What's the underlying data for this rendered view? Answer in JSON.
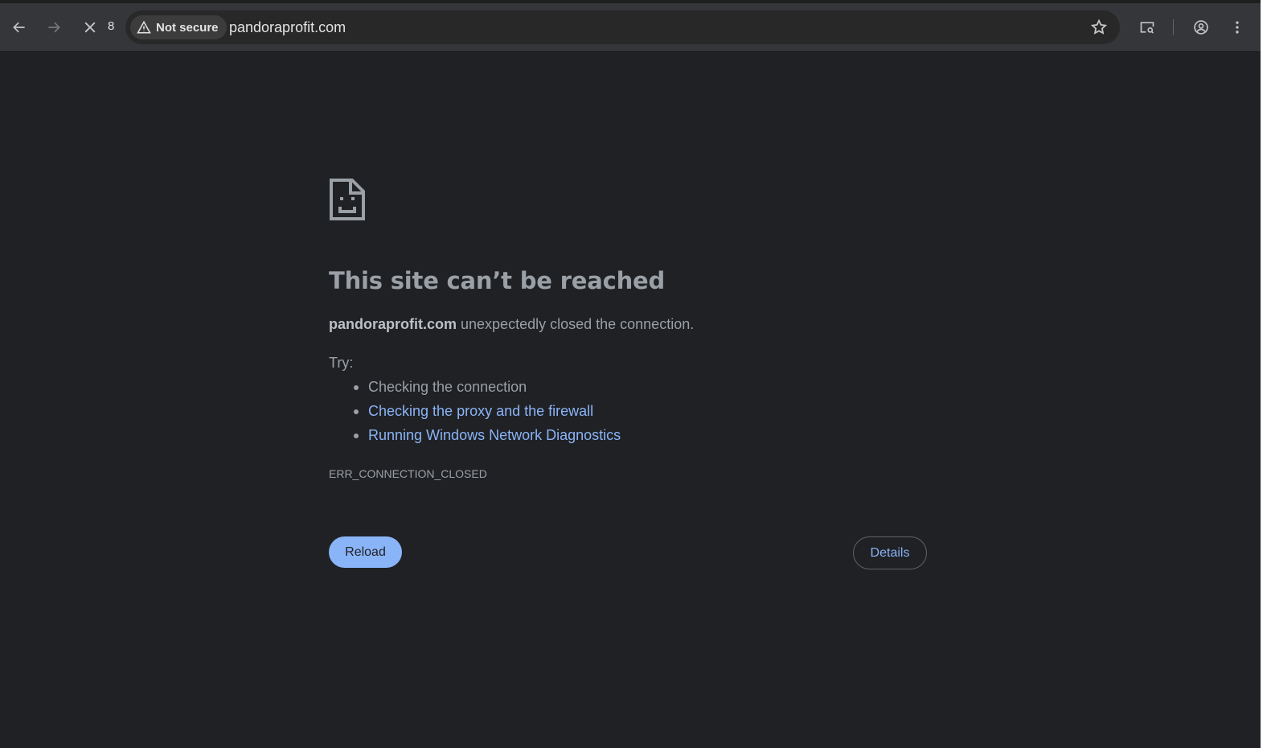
{
  "toolbar": {
    "tab_count": "8",
    "security_label": "Not secure",
    "url": "pandoraprofit.com",
    "icons": [
      "back-icon",
      "forward-icon",
      "stop-icon",
      "warning-icon",
      "star-icon",
      "cast-search-icon",
      "account-icon",
      "more-icon"
    ]
  },
  "error": {
    "title": "This site can’t be reached",
    "host": "pandoraprofit.com",
    "message": " unexpectedly closed the connection.",
    "try_label": "Try:",
    "suggestions": {
      "s0": "Checking the connection",
      "s1": "Checking the proxy and the firewall",
      "s2": "Running Windows Network Diagnostics"
    },
    "code": "ERR_CONNECTION_CLOSED",
    "reload_label": "Reload",
    "details_label": "Details"
  },
  "colors": {
    "background": "#202124",
    "link": "#8ab4f8",
    "text": "#9aa0a6",
    "primary_button": "#8ab4f8"
  }
}
